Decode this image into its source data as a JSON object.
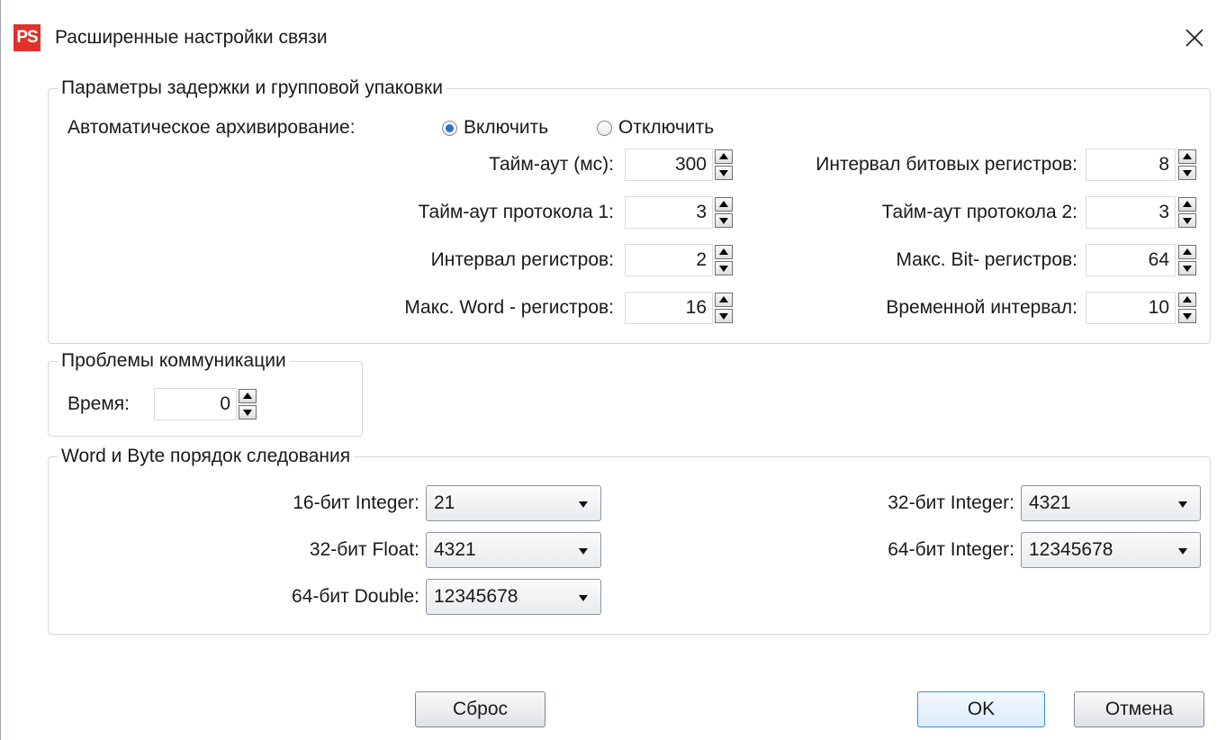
{
  "window": {
    "app_icon_text": "PS",
    "title": "Расширенные настройки связи",
    "close_glyph": "×"
  },
  "delay_group": {
    "legend": "Параметры задержки и групповой упаковки",
    "auto_archive_label": "Автоматическое архивирование:",
    "radio_enable": "Включить",
    "radio_disable": "Отключить",
    "selected": "enable",
    "timeout_label": "Тайм-аут (мс):",
    "timeout_value": "300",
    "proto1_label": "Тайм-аут протокола 1:",
    "proto1_value": "3",
    "reg_interval_label": "Интервал регистров:",
    "reg_interval_value": "2",
    "max_word_label": "Макс. Word - регистров:",
    "max_word_value": "16",
    "bit_interval_label": "Интервал битовых регистров:",
    "bit_interval_value": "8",
    "proto2_label": "Тайм-аут протокола 2:",
    "proto2_value": "3",
    "max_bit_label": "Макс. Bit- регистров:",
    "max_bit_value": "64",
    "time_interval_label": "Временной интервал:",
    "time_interval_value": "10"
  },
  "comm_group": {
    "legend": "Проблемы коммуникации",
    "time_label": "Время:",
    "time_value": "0"
  },
  "order_group": {
    "legend": "Word и Byte порядок следования",
    "int16_label": "16-бит Integer:",
    "int16_value": "21",
    "float32_label": "32-бит Float:",
    "float32_value": "4321",
    "double64_label": "64-бит Double:",
    "double64_value": "12345678",
    "int32_label": "32-бит Integer:",
    "int32_value": "4321",
    "int64_label": "64-бит Integer:",
    "int64_value": "12345678"
  },
  "buttons": {
    "reset": "Сброс",
    "ok": "OK",
    "cancel": "Отмена"
  },
  "colors": {
    "accent": "#2b73c6",
    "app_icon_bg": "#e0312b",
    "ok_border": "#3a8ee6"
  },
  "icons": {
    "close": "close-icon",
    "app": "app-icon",
    "spin": "spinner-arrows-icon",
    "dropdown": "chevron-down-icon"
  }
}
